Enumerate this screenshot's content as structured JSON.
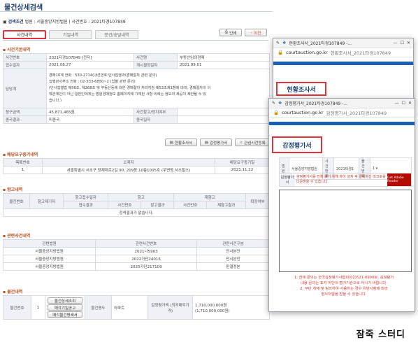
{
  "page": {
    "title": "물건상세검색",
    "breadcrumb_label": "검색조건",
    "breadcrumb_text": "법원 : 서울중앙지방법원 | 사건번호 : 2021타경107849",
    "print_label": "인쇄",
    "back_label": "이전"
  },
  "tabs": [
    {
      "label": "사건내역",
      "active": true
    },
    {
      "label": "기일내역",
      "active": false
    },
    {
      "label": "문건/송달내역",
      "active": false
    }
  ],
  "case_section": {
    "heading": "사건기본내역",
    "rows": [
      {
        "l1": "사건번호",
        "v1": "2021타경107849 [전자]",
        "l2": "사건명",
        "v2": "부동산임의경매"
      },
      {
        "l1": "접수일자",
        "v1": "2021.08.27",
        "l2": "개시결정일자",
        "v2": "2021.09.01"
      }
    ],
    "dept_label": "담당계",
    "dept_lines": [
      "경매10계    전화 : 530-2714(내선번호:민사집행과(경매절차 관련 문의)",
      "집행관사무소    전화 : 02-533-6850~2 (입찰 관련 문의)",
      "(민사집행법 제90조, 제268조 및 부동산등에 대한 경매절차 처리지침 제53조제1항에 따라, 경매절차의 이",
      "해관계인이 아닌 일반인에게는 법원경매정보 홈페이지에 기재된 사항 외에는 정보의 제공이 제한될 수 있",
      "습니다.)"
    ],
    "rows2": [
      {
        "l1": "청구금액",
        "v1": "45,871,465원",
        "l2": "사건항고/정지여부",
        "v2": ""
      },
      {
        "l1": "종국결과",
        "v1": "미종국",
        "l2": "종국일자",
        "v2": ""
      }
    ],
    "buttons": [
      "현황조사서",
      "감정평가서",
      "관심사건등록"
    ]
  },
  "dividend_section": {
    "heading": "배당요구종기내역",
    "headers": [
      "목록번호",
      "소재지",
      "배당요구종기일"
    ],
    "rows": [
      [
        "1",
        "서울특별시 서초구 양재대로2길 90, 209동 10층1005호 (우면동,서초힐스)",
        "2021.11.12"
      ]
    ]
  },
  "appeal_section": {
    "heading": "항고내역",
    "headers_top": [
      "물건번호",
      "항고제기자",
      "항고접수일자",
      "항고",
      "재항고",
      "확정여부"
    ],
    "headers_sub": [
      "접수결과",
      "사건번호",
      "항고결과",
      "사건번호",
      "재항고결과"
    ],
    "empty": "검색결과가 없습니다."
  },
  "related_section": {
    "heading": "관련사건내역",
    "headers": [
      "관련법원",
      "관련사건번호",
      "관련사건구분"
    ],
    "rows": [
      [
        "서울중앙지방법원",
        "2021나5903",
        "민사본안"
      ],
      [
        "서울중앙지방법원",
        "2022가단24016",
        "민사본안"
      ],
      [
        "서울중앙지방법원",
        "2020가단217109",
        "판결정본"
      ]
    ]
  },
  "item_section": {
    "heading": "물건내역",
    "label_no": "물건번호",
    "no": "1",
    "btns": [
      "물건상세조회",
      "매각기일공고",
      "매각물건명세서"
    ],
    "label_use": "물건용도",
    "use": "아파트",
    "label_price": "감정평가액 (최저매각가격)",
    "price": "1,710,000,000원",
    "price_min": "(1,710,000,000원)"
  },
  "popup1": {
    "title": "현황조사서_2021타경107849 -...",
    "domain": "courtauction.go.kr",
    "url_rest": "현황조사서_2021타경107849",
    "heading": "현황조사서"
  },
  "popup2": {
    "title": "감정평가서_2021타경107849 -...",
    "domain": "courtauction.go.kr",
    "url_rest": "감정평가서_2021타경107849",
    "heading": "감정평가서",
    "form_labels": [
      "법원",
      "사건번호",
      "물건번호"
    ],
    "form_values": [
      "서울중앙지방법원",
      "2021타경1",
      "1"
    ],
    "side_label": "감정평가서",
    "notice": "감정평가서를 전체 보기 위해 뷰어 설치 후 클릭하신 마크로를 다운받을 수 있습니다.",
    "viewer_label": "Get Adobe Reader",
    "warn1": "1. 전에 문의는 한국감정평가사협회(02)521-0900로, 감정평가",
    "warn2": "내용 문의는 표지 하단의 평가기관으로 하시기 바랍니다.",
    "warn3": "2. 무단 게재 및 링크하여 사용하는 경우 위반사항에 따라",
    "warn4": "형사처벌을 받을 수 있습니다."
  },
  "watermark": "잠죽 스터디"
}
